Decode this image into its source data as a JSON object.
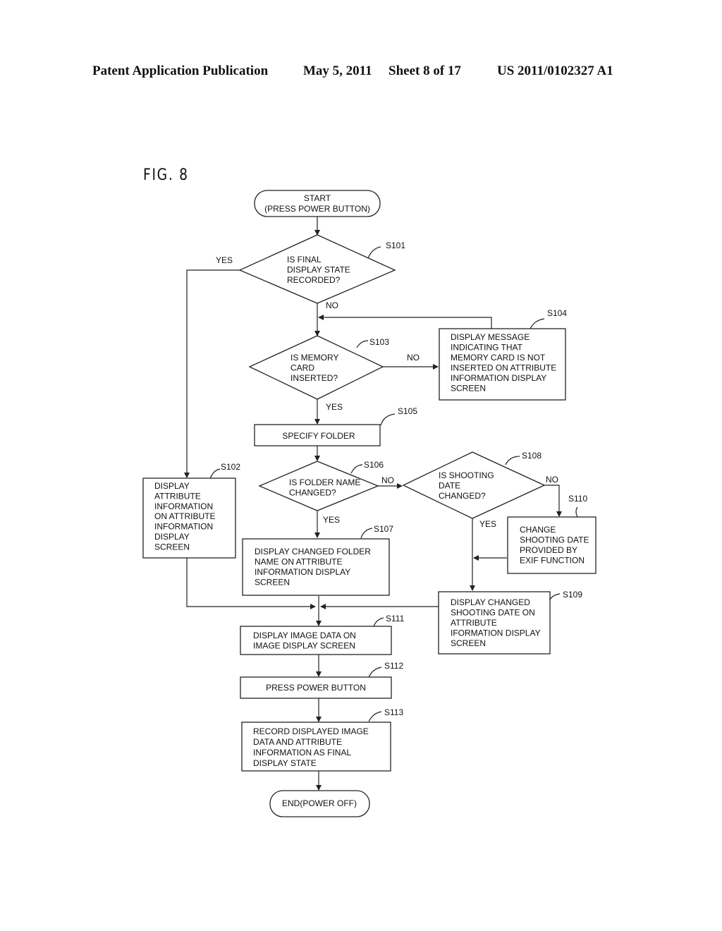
{
  "header": {
    "publication": "Patent Application Publication",
    "date": "May 5, 2011",
    "sheet": "Sheet 8 of 17",
    "number": "US 2011/0102327 A1"
  },
  "figure": {
    "label": "FIG. 8"
  },
  "nodes": {
    "start": {
      "lines": [
        "START",
        "(PRESS POWER BUTTON)"
      ]
    },
    "s101": {
      "id": "S101",
      "lines": [
        "IS FINAL",
        "DISPLAY STATE",
        "RECORDED?"
      ]
    },
    "s102": {
      "id": "S102",
      "lines": [
        "DISPLAY",
        "ATTRIBUTE",
        "INFORMATION",
        "ON ATTRIBUTE",
        "INFORMATION",
        "DISPLAY",
        "SCREEN"
      ]
    },
    "s103": {
      "id": "S103",
      "lines": [
        "IS MEMORY",
        "CARD",
        "INSERTED?"
      ]
    },
    "s104": {
      "id": "S104",
      "lines": [
        "DISPLAY MESSAGE",
        "INDICATING THAT",
        "MEMORY CARD IS NOT",
        "INSERTED ON ATTRIBUTE",
        "INFORMATION DISPLAY",
        "SCREEN"
      ]
    },
    "s105": {
      "id": "S105",
      "lines": [
        "SPECIFY FOLDER"
      ]
    },
    "s106": {
      "id": "S106",
      "lines": [
        "IS FOLDER NAME",
        "CHANGED?"
      ]
    },
    "s107": {
      "id": "S107",
      "lines": [
        "DISPLAY CHANGED FOLDER",
        "NAME ON ATTRIBUTE",
        "INFORMATION DISPLAY",
        "SCREEN"
      ]
    },
    "s108": {
      "id": "S108",
      "lines": [
        "IS SHOOTING",
        "DATE",
        "CHANGED?"
      ]
    },
    "s109": {
      "id": "S109",
      "lines": [
        "DISPLAY CHANGED",
        "SHOOTING DATE ON",
        "ATTRIBUTE",
        "IFORMATION DISPLAY",
        "SCREEN"
      ]
    },
    "s110": {
      "id": "S110",
      "lines": [
        "CHANGE",
        "SHOOTING DATE",
        "PROVIDED BY",
        "EXIF FUNCTION"
      ]
    },
    "s111": {
      "id": "S111",
      "lines": [
        "DISPLAY IMAGE DATA ON",
        "IMAGE DISPLAY SCREEN"
      ]
    },
    "s112": {
      "id": "S112",
      "lines": [
        "PRESS POWER BUTTON"
      ]
    },
    "s113": {
      "id": "S113",
      "lines": [
        "RECORD DISPLAYED IMAGE",
        "DATA AND ATTRIBUTE",
        "INFORMATION AS FINAL",
        "DISPLAY STATE"
      ]
    },
    "end": {
      "lines": [
        "END(POWER OFF)"
      ]
    }
  },
  "edge_labels": {
    "s101_yes": "YES",
    "s101_no": "NO",
    "s103_no": "NO",
    "s103_yes": "YES",
    "s106_no": "NO",
    "s106_yes": "YES",
    "s108_no": "NO",
    "s108_yes": "YES"
  }
}
